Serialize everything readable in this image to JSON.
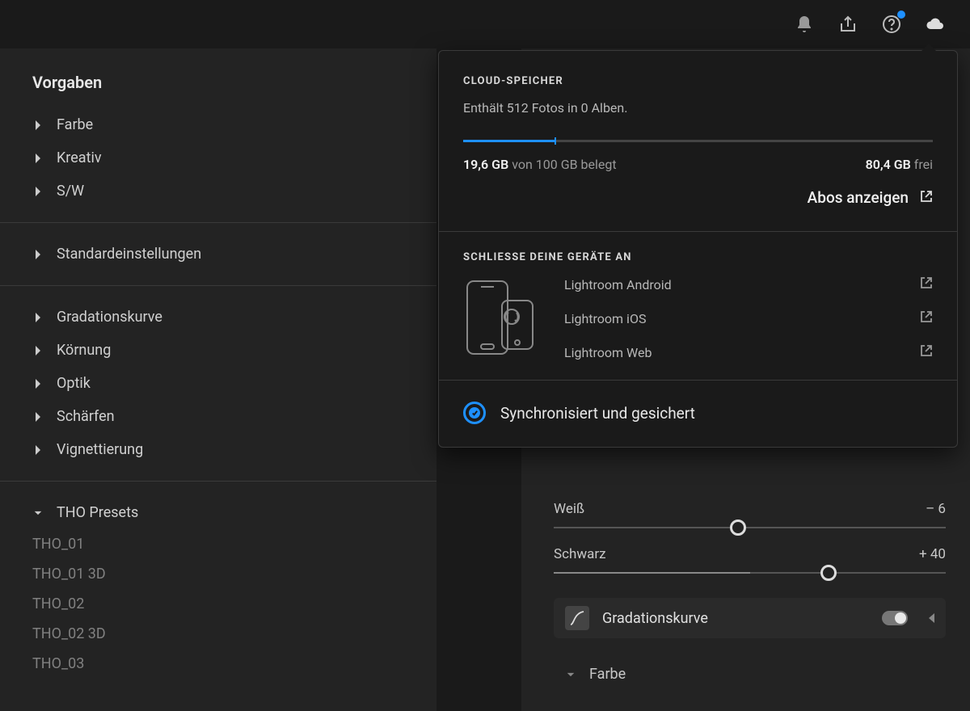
{
  "sidebar": {
    "title": "Vorgaben",
    "group_color": [
      {
        "label": "Farbe"
      },
      {
        "label": "Kreativ"
      },
      {
        "label": "S/W"
      }
    ],
    "defaults_label": "Standardeinstellungen",
    "group_adjust": [
      {
        "label": "Gradationskurve"
      },
      {
        "label": "Körnung"
      },
      {
        "label": "Optik"
      },
      {
        "label": "Schärfen"
      },
      {
        "label": "Vignettierung"
      }
    ],
    "presets_header": "THO Presets",
    "presets": [
      "THO_01",
      "THO_01 3D",
      "THO_02",
      "THO_02 3D",
      "THO_03"
    ]
  },
  "edit": {
    "white_label": "Weiß",
    "white_value": "– 6",
    "white_pos_percent": 47,
    "black_label": "Schwarz",
    "black_value": "+ 40",
    "black_pos_percent": 70,
    "curve_label": "Gradationskurve",
    "color_label": "Farbe"
  },
  "popover": {
    "storage_title": "CLOUD-SPEICHER",
    "storage_desc": "Enthält 512 Fotos in 0 Alben.",
    "used_bold": "19,6 GB",
    "used_text": "von 100 GB belegt",
    "free_bold": "80,4 GB",
    "free_text": "frei",
    "progress_percent": 19.6,
    "abos_label": "Abos anzeigen",
    "devices_title": "SCHLIESSE DEINE GERÄTE AN",
    "devices": [
      {
        "label": "Lightroom Android"
      },
      {
        "label": "Lightroom iOS"
      },
      {
        "label": "Lightroom Web"
      }
    ],
    "sync_text": "Synchronisiert und gesichert"
  }
}
